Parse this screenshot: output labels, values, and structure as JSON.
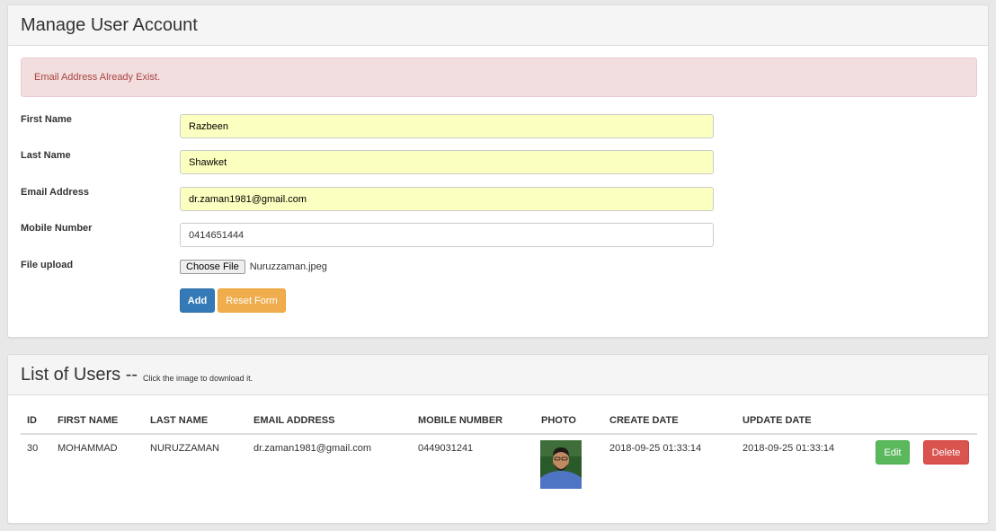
{
  "manage": {
    "title": "Manage User Account",
    "alert": "Email Address Already Exist.",
    "fields": [
      {
        "label": "First Name",
        "value": "Razbeen"
      },
      {
        "label": "Last Name",
        "value": "Shawket"
      },
      {
        "label": "Email Address",
        "value": "dr.zaman1981@gmail.com"
      },
      {
        "label": "Mobile Number",
        "value": "0414651444"
      }
    ],
    "file": {
      "label": "File upload",
      "button": "Choose File",
      "filename": "Nuruzzaman.jpeg"
    },
    "buttons": {
      "add": "Add",
      "reset": "Reset Form"
    }
  },
  "list": {
    "title": "List of Users --",
    "subtitle": "Click the image to download it.",
    "columns": [
      "ID",
      "FIRST NAME",
      "LAST NAME",
      "EMAIL ADDRESS",
      "MOBILE NUMBER",
      "PHOTO",
      "CREATE DATE",
      "UPDATE DATE"
    ],
    "rows": [
      {
        "id": "30",
        "first_name": "MOHAMMAD",
        "last_name": "NURUZZAMAN",
        "email": "dr.zaman1981@gmail.com",
        "mobile": "0449031241",
        "create_date": "2018-09-25 01:33:14",
        "update_date": "2018-09-25 01:33:14",
        "edit": "Edit",
        "delete": "Delete"
      }
    ]
  },
  "colors": {
    "primary": "#337ab7",
    "warning": "#f0ad4e",
    "success": "#5cb85c",
    "danger": "#d9534f",
    "alert_bg": "#f2dede",
    "alert_text": "#a94442",
    "autofill": "#fbffbf"
  }
}
